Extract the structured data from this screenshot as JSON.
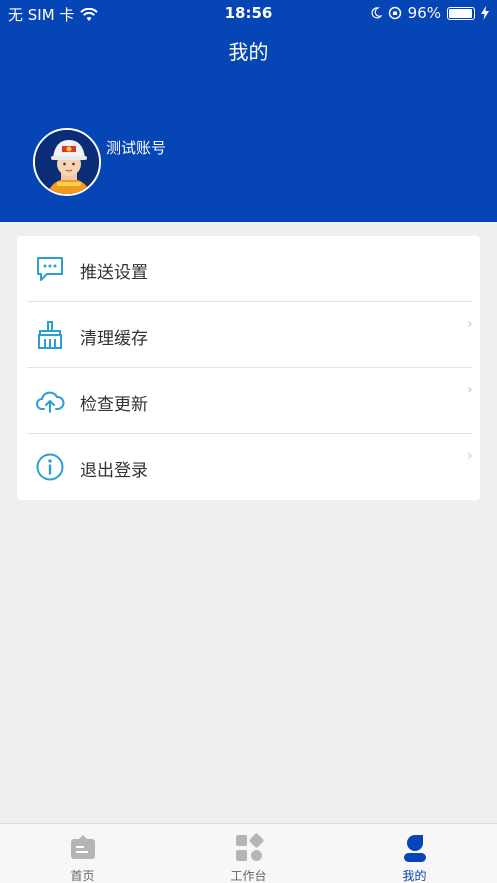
{
  "status_bar": {
    "carrier": "无 SIM 卡",
    "time": "18:56",
    "battery_percent": "96%",
    "battery_level": 0.96
  },
  "header": {
    "title": "我的",
    "background_color": "#0645b5"
  },
  "profile": {
    "account_name": "测试账号",
    "avatar_icon": "firefighter-avatar-icon"
  },
  "menu": {
    "items": [
      {
        "label": "推送设置",
        "icon": "message-bubble-icon"
      },
      {
        "label": "清理缓存",
        "icon": "broom-icon"
      },
      {
        "label": "检查更新",
        "icon": "cloud-upload-icon"
      },
      {
        "label": "退出登录",
        "icon": "info-icon"
      }
    ],
    "icon_color": "#2a9fd6"
  },
  "tab_bar": {
    "tabs": [
      {
        "label": "首页",
        "icon": "home-icon",
        "active": false
      },
      {
        "label": "工作台",
        "icon": "workbench-icon",
        "active": false
      },
      {
        "label": "我的",
        "icon": "person-icon",
        "active": true
      }
    ],
    "active_color": "#0645b5"
  }
}
